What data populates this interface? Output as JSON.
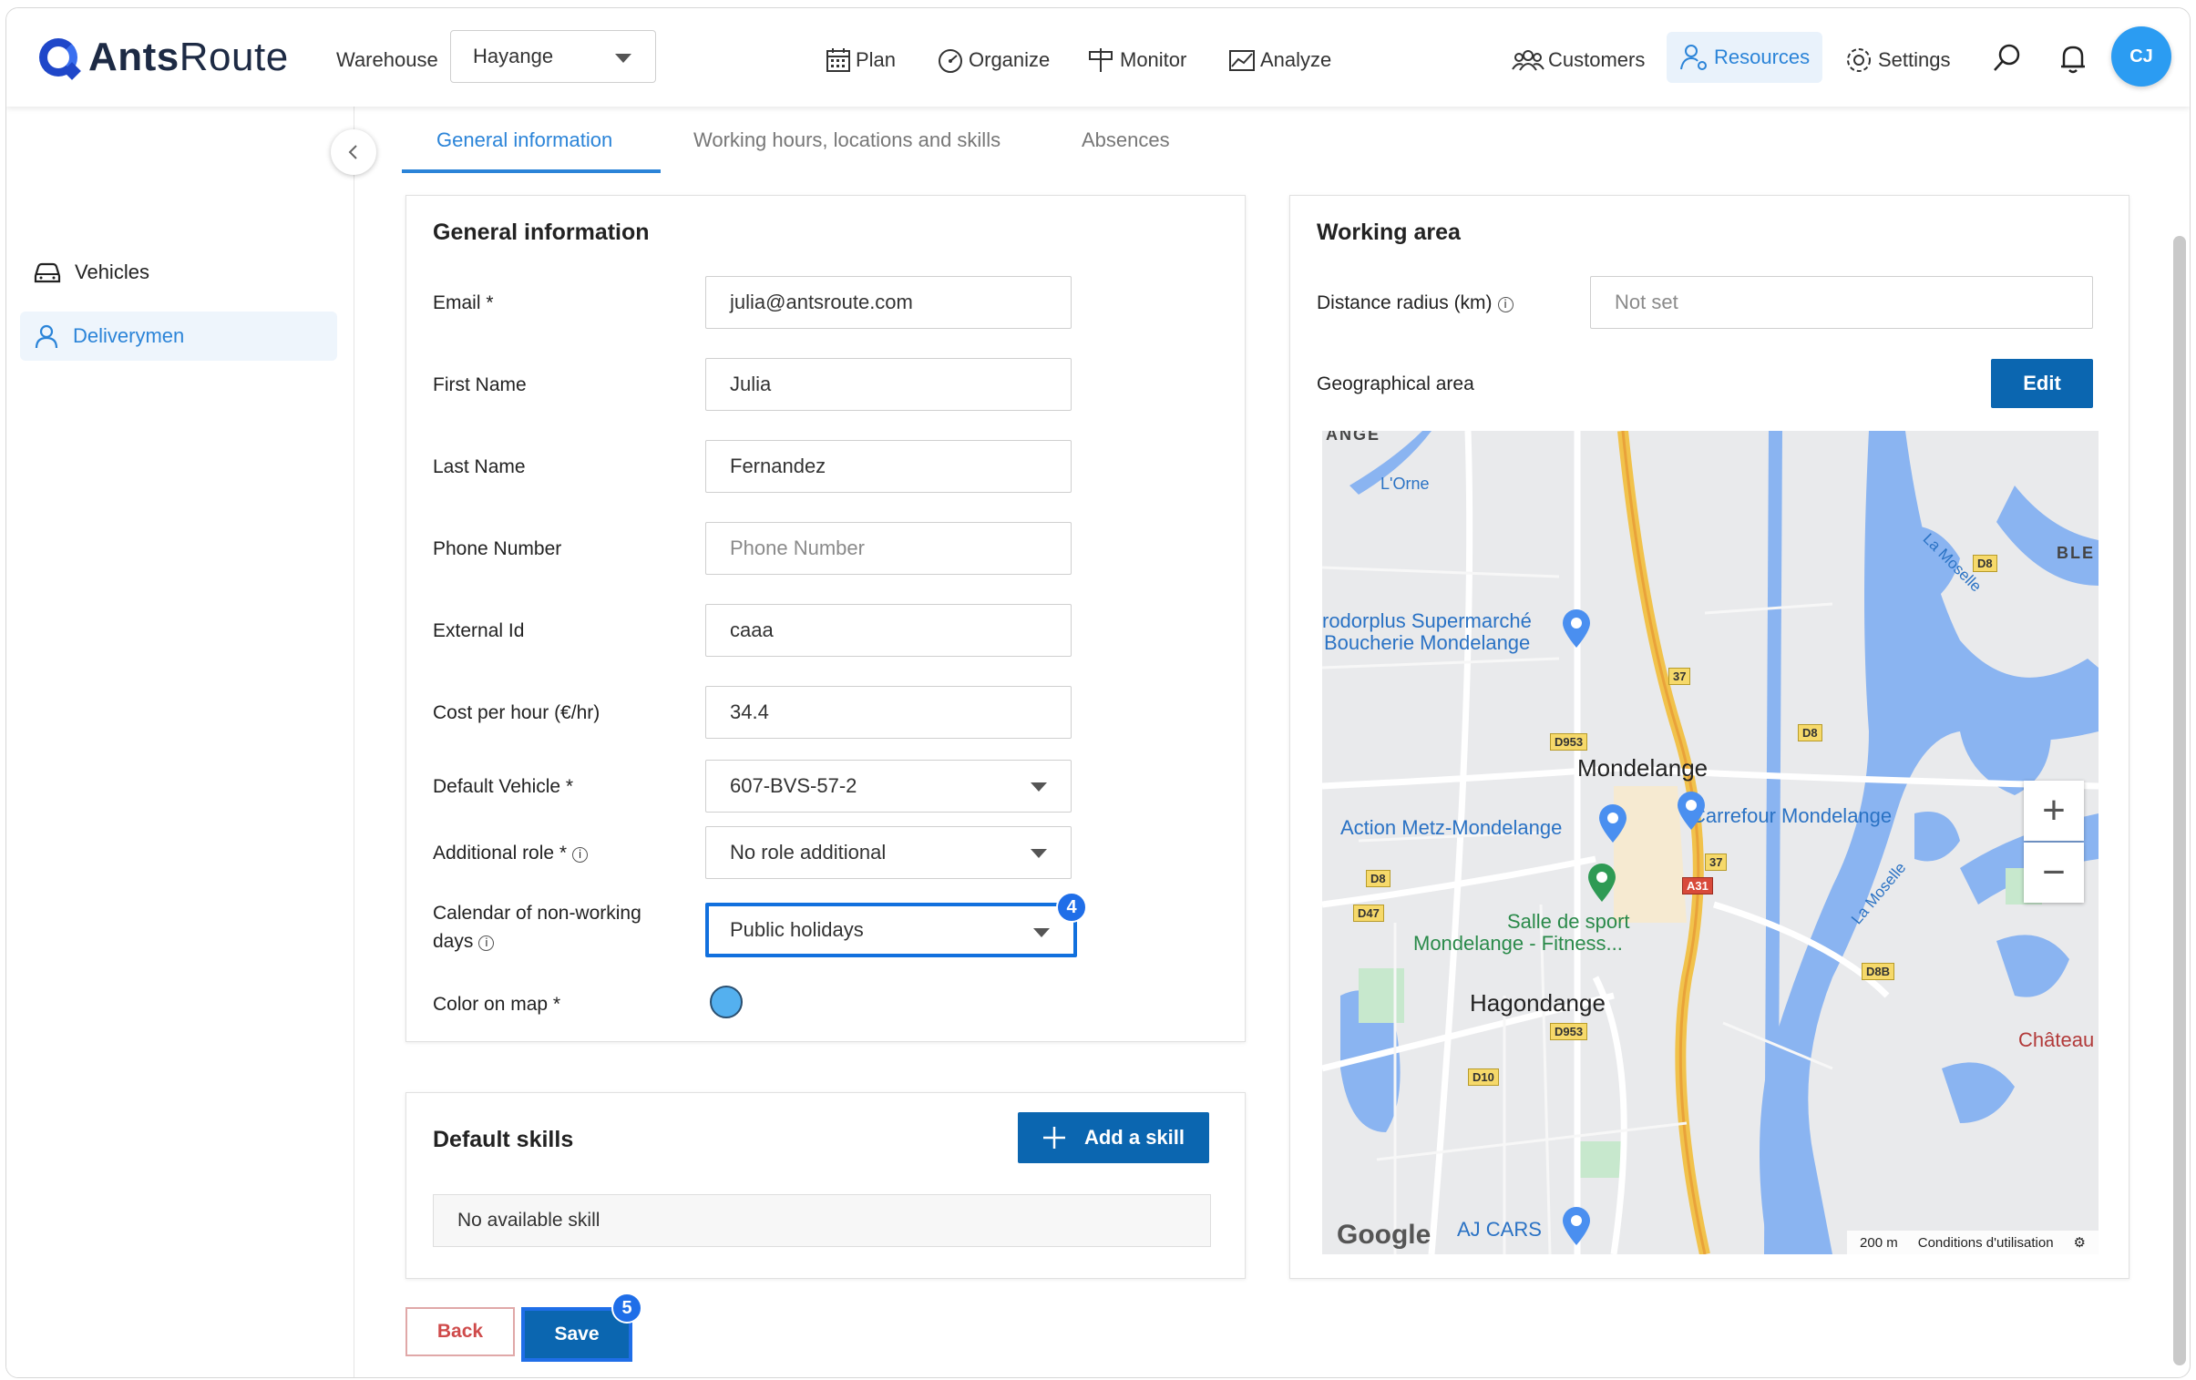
{
  "app": {
    "logo_text_bold": "Ants",
    "logo_text_light": "Route",
    "user_initials": "CJ"
  },
  "header": {
    "warehouse_label": "Warehouse",
    "warehouse_value": "Hayange",
    "nav": [
      {
        "label": "Plan",
        "icon": "calendar-icon"
      },
      {
        "label": "Organize",
        "icon": "gauge-icon"
      },
      {
        "label": "Monitor",
        "icon": "signpost-icon"
      },
      {
        "label": "Analyze",
        "icon": "chart-icon"
      }
    ],
    "right_nav": [
      {
        "label": "Customers",
        "icon": "people-icon"
      },
      {
        "label": "Resources",
        "icon": "resources-icon",
        "active": true
      },
      {
        "label": "Settings",
        "icon": "gear-icon"
      }
    ]
  },
  "sidebar": {
    "items": [
      {
        "label": "Vehicles",
        "icon": "car-icon",
        "active": false
      },
      {
        "label": "Deliverymen",
        "icon": "user-icon",
        "active": true
      }
    ]
  },
  "tabs": [
    {
      "label": "General information",
      "active": true
    },
    {
      "label": "Working hours, locations and skills",
      "active": false
    },
    {
      "label": "Absences",
      "active": false
    }
  ],
  "general": {
    "title": "General information",
    "fields": {
      "email": {
        "label": "Email *",
        "value": "julia@antsroute.com"
      },
      "first_name": {
        "label": "First Name",
        "value": "Julia"
      },
      "last_name": {
        "label": "Last Name",
        "value": "Fernandez"
      },
      "phone": {
        "label": "Phone Number",
        "placeholder": "Phone Number",
        "value": ""
      },
      "external_id": {
        "label": "External Id",
        "value": "caaa"
      },
      "cost": {
        "label": "Cost per hour (€/hr)",
        "value": "34.4"
      },
      "default_vehicle": {
        "label": "Default Vehicle *",
        "value": "607-BVS-57-2"
      },
      "additional_role": {
        "label": "Additional role *",
        "value": "No role additional"
      },
      "calendar": {
        "label_line1": "Calendar of non-working",
        "label_line2": "days",
        "value": "Public holidays",
        "step_badge": "4"
      },
      "color": {
        "label": "Color on map *",
        "value": "#54b0ef"
      }
    }
  },
  "skills": {
    "title": "Default skills",
    "add_label": "Add a skill",
    "empty_text": "No available skill"
  },
  "working_area": {
    "title": "Working area",
    "radius_label": "Distance radius (km)",
    "radius_placeholder": "Not set",
    "geo_label": "Geographical area",
    "edit_label": "Edit"
  },
  "map": {
    "labels": {
      "ange": "ANGE",
      "orne": "L'Orne",
      "ble": "BLE",
      "moselle1": "La Moselle",
      "moselle2": "La Moselle",
      "super1": "rodorplus Supermarché",
      "super2": "Boucherie Mondelange",
      "mondelange": "Mondelange",
      "carrefour": "Carrefour Mondelange",
      "action": "Action Metz-Mondelange",
      "salle1": "Salle de sport",
      "salle2": "Mondelange - Fitness...",
      "hagondange": "Hagondange",
      "chateau": "Château",
      "ajcars": "AJ CARS",
      "google": "Google",
      "scale": "200 m",
      "terms": "Conditions d'utilisation"
    },
    "road_tags": [
      "D8",
      "37",
      "D953",
      "D8",
      "D8",
      "D47",
      "A31",
      "37",
      "D8B",
      "D953",
      "D10"
    ],
    "zoom_in": "+",
    "zoom_out": "−"
  },
  "actions": {
    "back_label": "Back",
    "save_label": "Save",
    "save_badge": "5"
  },
  "colors": {
    "accent": "#2b84d8",
    "primary_button": "#0b66b0",
    "focus": "#1f6ee8",
    "back_text": "#cf4b4b"
  }
}
